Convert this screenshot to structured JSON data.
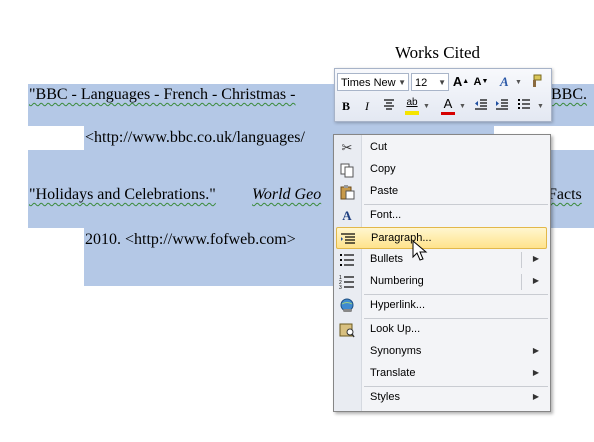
{
  "document": {
    "heading": "Works Cited",
    "lines": [
      "\"BBC - Languages - French - Christmas -",
      "BBC.",
      "<http://www.bbc.co.uk/languages/",
      "\"Holidays and Celebrations.\"",
      "World Geo",
      "Facts",
      "2010. <http://www.fofweb.com>"
    ]
  },
  "mini_toolbar": {
    "font_name": "Times New",
    "font_size": "12",
    "grow_label": "A",
    "shrink_label": "A",
    "bold": "B",
    "italic": "I",
    "highlight_label": "ab",
    "font_color_label": "A",
    "colors": {
      "highlight": "#f5e400",
      "font_color": "#d60000"
    }
  },
  "context_menu": {
    "items": [
      {
        "label": "Cut",
        "icon": "scissors-icon"
      },
      {
        "label": "Copy",
        "icon": "copy-icon"
      },
      {
        "label": "Paste",
        "icon": "paste-icon"
      },
      {
        "label": "Font...",
        "icon": "font-icon"
      },
      {
        "label": "Paragraph...",
        "icon": "paragraph-icon",
        "highlighted": true
      },
      {
        "label": "Bullets",
        "icon": "bullets-icon",
        "submenu": true
      },
      {
        "label": "Numbering",
        "icon": "numbering-icon",
        "submenu": true
      },
      {
        "label": "Hyperlink...",
        "icon": "hyperlink-icon"
      },
      {
        "label": "Look Up...",
        "icon": "lookup-icon"
      },
      {
        "label": "Synonyms",
        "submenu": true
      },
      {
        "label": "Translate",
        "submenu": true
      },
      {
        "label": "Styles",
        "submenu": true
      }
    ]
  }
}
